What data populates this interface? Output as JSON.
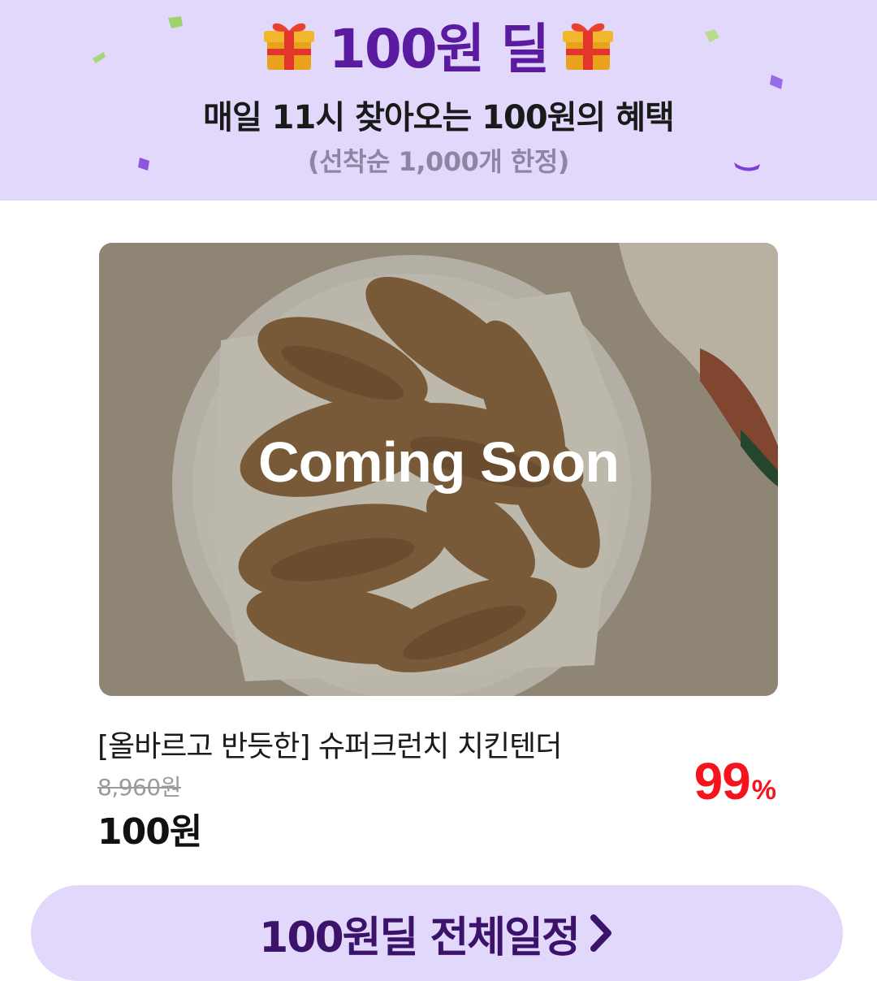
{
  "banner": {
    "title": "100원 딜",
    "subtitle": "매일 11시 찾아오는 100원의 혜택",
    "note": "(선착순 1,000개 한정)",
    "icons": [
      "gift-icon",
      "gift-icon",
      "confetti"
    ],
    "colors": {
      "background": "#e2d8fb",
      "title": "#5b1ba0",
      "note": "#8d86a3"
    }
  },
  "product": {
    "status_overlay": "Coming Soon",
    "name": "[올바르고 반듯한] 슈퍼크런치 치킨텐더",
    "original_price": "8,960원",
    "sale_price": "100원",
    "discount_value": "99",
    "discount_unit": "%",
    "colors": {
      "discount": "#f5141e"
    }
  },
  "cta": {
    "label": "100원딜 전체일정",
    "icon": "chevron-right-icon",
    "colors": {
      "background": "#e2d8fb",
      "text": "#3c136a"
    }
  }
}
